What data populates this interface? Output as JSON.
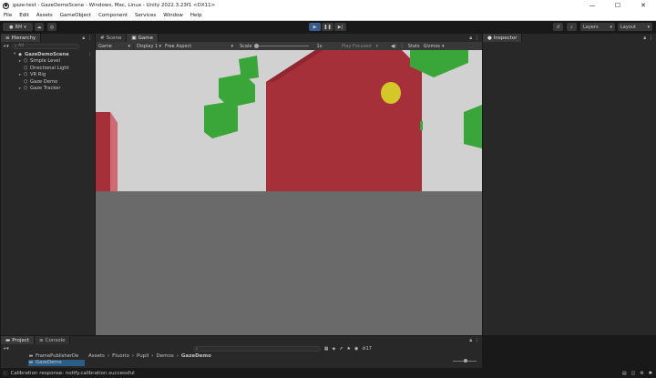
{
  "window": {
    "title": "gaze-test - GazeDemoScene - Windows, Mac, Linux - Unity 2022.3.23f1 <DX11>",
    "controls": [
      "minimize",
      "maximize",
      "close"
    ]
  },
  "menu": [
    "File",
    "Edit",
    "Assets",
    "GameObject",
    "Component",
    "Services",
    "Window",
    "Help"
  ],
  "toolbar": {
    "account_label": "BM",
    "layers_label": "Layers",
    "layout_label": "Layout"
  },
  "hierarchy": {
    "tab_label": "Hierarchy",
    "search_placeholder": "All",
    "scene": "GazeDemoScene",
    "items": [
      "Simple Level",
      "Directional Light",
      "VR Rig",
      "Gaze Demo",
      "Gaze Tracker"
    ]
  },
  "game": {
    "tabs": [
      "Scene",
      "Game"
    ],
    "active_tab": "Game",
    "mode": "Game",
    "display": "Display 1",
    "aspect": "Free Aspect",
    "scale_label": "Scale",
    "scale_value": "1x",
    "play_focus": "Play Focused",
    "stats_label": "Stats",
    "gizmos_label": "Gizmos",
    "colors": {
      "sky": "#d1d1d1",
      "floor": "#6a6a6a",
      "wall": "#a6303a",
      "cube": "#3aa63a",
      "target": "#d4c72a"
    }
  },
  "inspector": {
    "tab_label": "Inspector"
  },
  "bottom": {
    "tabs": [
      "Project",
      "Console"
    ],
    "breadcrumb": [
      "Assets",
      "Fluorio",
      "Pupil",
      "Demos",
      "GazeDemo"
    ],
    "folders": [
      "FramePublisherDe",
      "GazeDemo"
    ],
    "count": "17"
  },
  "status": {
    "message": "Calibration response: notify.calibration.successful"
  }
}
